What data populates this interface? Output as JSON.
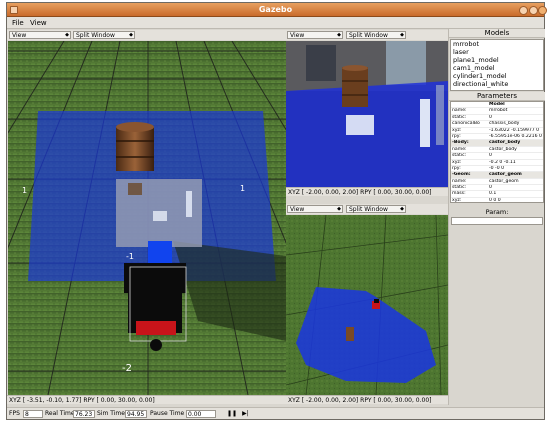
{
  "window": {
    "title": "Gazebo"
  },
  "menu": {
    "file": "File",
    "view": "View"
  },
  "views": {
    "main": {
      "view_label": "View",
      "split_label": "Split Window",
      "status": "XYZ [ -3.51, -0.10,   1.77] RPY [  0.00,  30.00,   0.00]"
    },
    "top_right": {
      "view_label": "View",
      "split_label": "Split Window",
      "status": "XYZ [ -2.00,   0.00,   2.00] RPY [  0.00,  30.00,   0.00]"
    },
    "bottom_right": {
      "view_label": "View",
      "split_label": "Split Window",
      "status": "XYZ [ -2.00,   0.00,   2.00] RPY [  0.00,  30.00,   0.00]"
    }
  },
  "scene_labels": {
    "left_1": "1",
    "right_1": "1",
    "minus_1": "-1",
    "minus_2": "-2"
  },
  "models": {
    "header": "Models",
    "items": [
      "mrrobot",
      "laser",
      "plane1_model",
      "cam1_model",
      "cylinder1_model",
      "directional_white"
    ]
  },
  "parameters": {
    "header": "Parameters",
    "rows": [
      {
        "k": "",
        "v": "Model",
        "type": "head"
      },
      {
        "k": "name:",
        "v": "mrrobot",
        "type": "row"
      },
      {
        "k": "static:",
        "v": "0",
        "type": "row"
      },
      {
        "k": "canonicalBo",
        "v": "chassis_body",
        "type": "row"
      },
      {
        "k": "xyz:",
        "v": "-1.63022 -0.159977 0",
        "type": "row"
      },
      {
        "k": "rpy:",
        "v": "-6.55951e-06 0.2216 0",
        "type": "row"
      },
      {
        "k": "-Body:",
        "v": "castor_body",
        "type": "group"
      },
      {
        "k": "name:",
        "v": "castor_body",
        "type": "row"
      },
      {
        "k": "static:",
        "v": "0",
        "type": "row"
      },
      {
        "k": "xyz:",
        "v": "-0.2 0 -0.11",
        "type": "row"
      },
      {
        "k": "rpy:",
        "v": "-0 -0 0",
        "type": "row"
      },
      {
        "k": "-Geom:",
        "v": "castor_geom",
        "type": "group"
      },
      {
        "k": "name:",
        "v": "castor_geom",
        "type": "row"
      },
      {
        "k": "static:",
        "v": "0",
        "type": "row"
      },
      {
        "k": "mass:",
        "v": "0.1",
        "type": "row"
      },
      {
        "k": "xyz:",
        "v": "0 0 0",
        "type": "row"
      }
    ],
    "param_label": "Param:",
    "param_value": ""
  },
  "bottombar": {
    "fps_label": "FPS",
    "fps_value": "8",
    "real_time_label": "Real Time",
    "real_time_value": "76.23",
    "sim_time_label": "Sim Time",
    "sim_time_value": "94.95",
    "pause_time_label": "Pause Time",
    "pause_time_value": "0.00",
    "pause_btn": "❚❚",
    "step_btn": "▶|"
  }
}
